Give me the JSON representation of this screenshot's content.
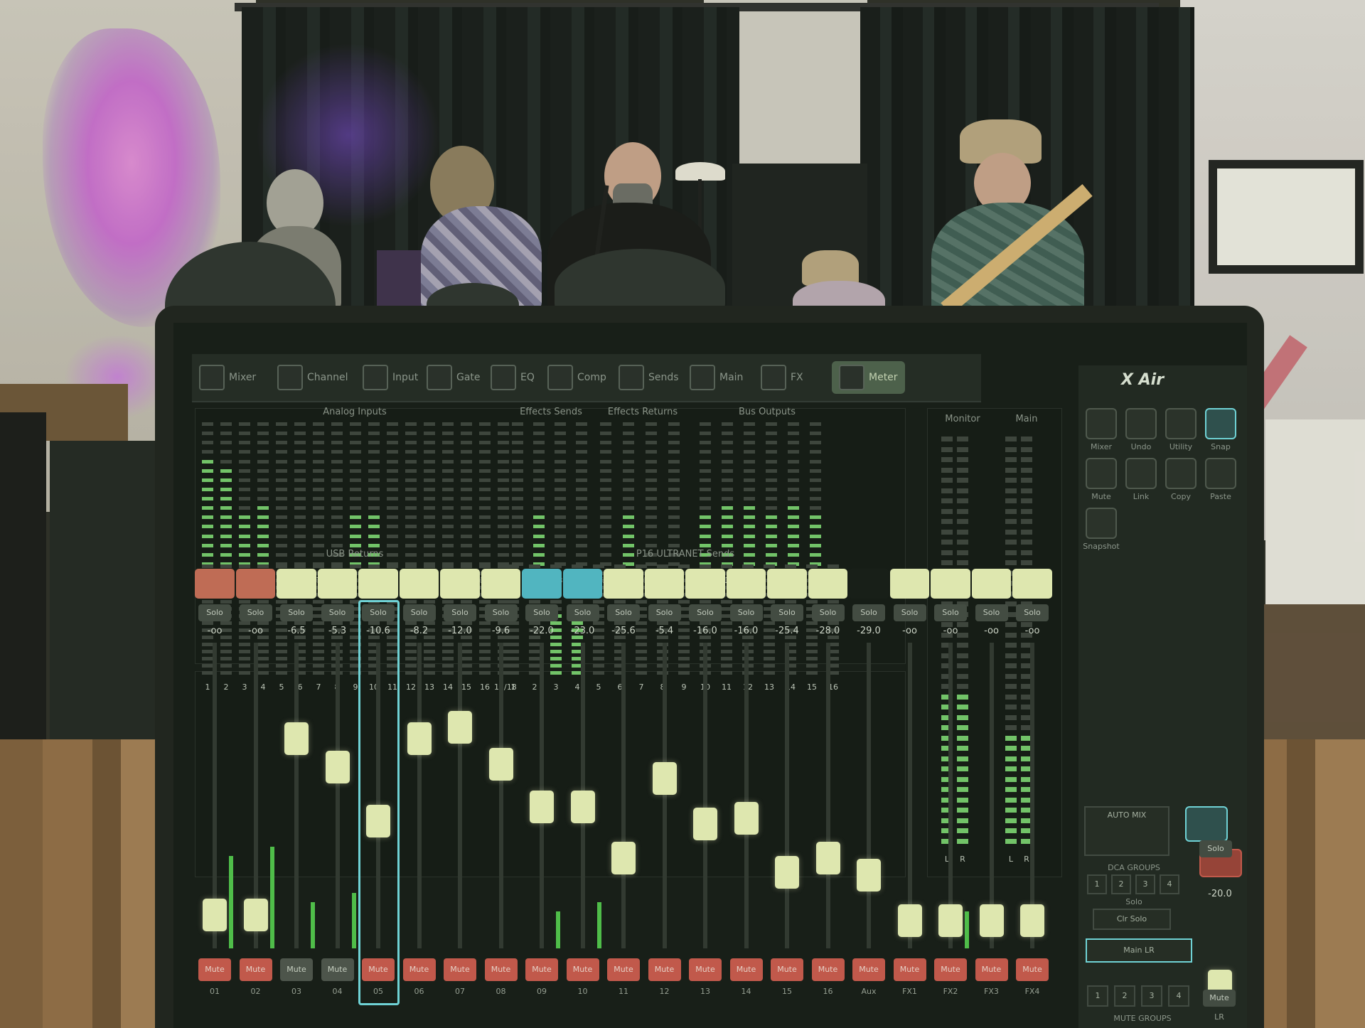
{
  "mixer": {
    "toolbar_tabs": [
      {
        "label": "Mixer",
        "icon": "mixer-icon"
      },
      {
        "label": "Channel",
        "icon": "channel-icon"
      },
      {
        "label": "Input",
        "icon": "input-icon"
      },
      {
        "label": "Gate",
        "icon": "gate-icon"
      },
      {
        "label": "EQ",
        "icon": "eq-icon"
      },
      {
        "label": "Comp",
        "icon": "comp-icon"
      },
      {
        "label": "Sends",
        "icon": "sends-icon"
      },
      {
        "label": "Main",
        "icon": "main-icon"
      },
      {
        "label": "FX",
        "icon": "fx-icon"
      },
      {
        "label": "Meter",
        "icon": "meter-icon",
        "active": true
      }
    ],
    "meter_groups": {
      "analog_inputs": {
        "label": "Analog Inputs",
        "channels": [
          "1",
          "2",
          "3",
          "4",
          "5",
          "6",
          "7",
          "8",
          "9",
          "10",
          "11",
          "12",
          "13",
          "14",
          "15",
          "16",
          "17/18"
        ],
        "levels": [
          0.75,
          0.7,
          0.35,
          0.45,
          0,
          0,
          0,
          0,
          0.35,
          0.35,
          0,
          0,
          0,
          0,
          0,
          0,
          0
        ]
      },
      "effects_sends": {
        "label": "Effects Sends",
        "channels": [
          "1",
          "2",
          "3",
          "4"
        ],
        "levels": [
          0,
          0.35,
          0,
          0
        ]
      },
      "effects_returns": {
        "label": "Effects Returns",
        "channels": [
          "FX1",
          "FX2",
          "FX3",
          "FX4"
        ],
        "levels": [
          0,
          0.35,
          0,
          0
        ]
      },
      "bus_outputs": {
        "label": "Bus Outputs",
        "channels": [
          "1",
          "2",
          "3",
          "4",
          "5",
          "6"
        ],
        "levels": [
          0.4,
          0.45,
          0.45,
          0.4,
          0.45,
          0.4
        ]
      },
      "monitor": {
        "label": "Monitor",
        "channels": [
          "L",
          "R"
        ]
      },
      "main": {
        "label": "Main",
        "channels": [
          "L",
          "R"
        ]
      },
      "usb_returns": {
        "label": "USB Returns",
        "channels": [
          "1",
          "2",
          "3",
          "4",
          "5",
          "6",
          "7",
          "8",
          "9",
          "10",
          "11",
          "12",
          "13",
          "14",
          "15",
          "16",
          "17/18"
        ],
        "levels": [
          0,
          0,
          0,
          0,
          0,
          0,
          0,
          0,
          0,
          0,
          0,
          0,
          0,
          0,
          0,
          0,
          0
        ]
      },
      "p16_sends": {
        "label": "P16 ULTRANET Sends",
        "channels": [
          "1",
          "2",
          "3",
          "4",
          "5",
          "6",
          "7",
          "8",
          "9",
          "10",
          "11",
          "12",
          "13",
          "14",
          "15",
          "16"
        ],
        "levels": [
          0,
          0,
          0.55,
          0.6,
          0,
          0,
          0,
          0,
          0,
          0,
          0,
          0,
          0,
          0,
          0,
          0
        ]
      }
    },
    "strips": [
      {
        "name": "01",
        "db": "-oo",
        "fader": 0.1,
        "muted": true,
        "vu": 0.5,
        "label_color": "#c66a55"
      },
      {
        "name": "02",
        "db": "-oo",
        "fader": 0.1,
        "muted": true,
        "vu": 0.55,
        "label_color": "#c66a55"
      },
      {
        "name": "03",
        "db": "-6.5",
        "fader": 0.72,
        "muted": false,
        "vu": 0.25,
        "label_color": "#e8efb7"
      },
      {
        "name": "04",
        "db": "-5.3",
        "fader": 0.62,
        "muted": false,
        "vu": 0.3,
        "label_color": "#e8efb7"
      },
      {
        "name": "05",
        "db": "-10.6",
        "fader": 0.43,
        "muted": true,
        "vu": 0,
        "label_color": "#e8efb7"
      },
      {
        "name": "06",
        "db": "-8.2",
        "fader": 0.72,
        "muted": true,
        "vu": 0,
        "label_color": "#e8efb7"
      },
      {
        "name": "07",
        "db": "-12.0",
        "fader": 0.76,
        "muted": true,
        "vu": 0,
        "label_color": "#e8efb7"
      },
      {
        "name": "08",
        "db": "-9.6",
        "fader": 0.63,
        "muted": true,
        "vu": 0,
        "label_color": "#e8efb7"
      },
      {
        "name": "09",
        "db": "-22.0",
        "fader": 0.48,
        "muted": true,
        "vu": 0.2,
        "label_color": "#4fb9c9"
      },
      {
        "name": "10",
        "db": "-23.0",
        "fader": 0.48,
        "muted": true,
        "vu": 0.25,
        "label_color": "#4fb9c9"
      },
      {
        "name": "11",
        "db": "-25.6",
        "fader": 0.3,
        "muted": true,
        "vu": 0,
        "label_color": "#e8efb7"
      },
      {
        "name": "12",
        "db": "-5.4",
        "fader": 0.58,
        "muted": true,
        "vu": 0,
        "label_color": "#e8efb7"
      },
      {
        "name": "13",
        "db": "-16.0",
        "fader": 0.42,
        "muted": true,
        "vu": 0,
        "label_color": "#e8efb7"
      },
      {
        "name": "14",
        "db": "-16.0",
        "fader": 0.44,
        "muted": true,
        "vu": 0,
        "label_color": "#e8efb7"
      },
      {
        "name": "15",
        "db": "-25.4",
        "fader": 0.25,
        "muted": true,
        "vu": 0,
        "label_color": "#e8efb7"
      },
      {
        "name": "16",
        "db": "-28.0",
        "fader": 0.3,
        "muted": true,
        "vu": 0,
        "label_color": "#e8efb7"
      },
      {
        "name": "Aux",
        "db": "-29.0",
        "fader": 0.24,
        "muted": true,
        "vu": 0,
        "label_color": "#111613"
      },
      {
        "name": "FX1",
        "db": "-oo",
        "fader": 0.08,
        "muted": true,
        "vu": 0,
        "label_color": "#e8efb7"
      },
      {
        "name": "FX2",
        "db": "-oo",
        "fader": 0.08,
        "muted": true,
        "vu": 0.2,
        "label_color": "#e8efb7"
      },
      {
        "name": "FX3",
        "db": "-oo",
        "fader": 0.08,
        "muted": true,
        "vu": 0,
        "label_color": "#e8efb7"
      },
      {
        "name": "FX4",
        "db": "-oo",
        "fader": 0.08,
        "muted": true,
        "vu": 0,
        "label_color": "#e8efb7"
      }
    ],
    "strip_solo_label": "Solo",
    "strip_mute_label": "Mute",
    "selected_strip": 4,
    "sidebar": {
      "brand": "X Air",
      "auto_mix_label": "AUTO MIX",
      "dca_groups_label": "DCA GROUPS",
      "mute_groups_label": "MUTE GROUPS",
      "solo_label": "Solo",
      "clear_solo_label": "Clr Solo",
      "main_lr_label": "Main LR",
      "main_lr_db": "-20.0",
      "main_lr_name": "LR",
      "main_lr_mute_label": "Mute",
      "dca_numbers": [
        "1",
        "2",
        "3",
        "4"
      ],
      "mute_group_numbers": [
        "1",
        "2",
        "3",
        "4"
      ],
      "buttons": [
        "Mixer",
        "Undo",
        "Utility",
        "Snap",
        "Mute",
        "Link",
        "Copy",
        "Paste",
        "Snapshot"
      ]
    }
  }
}
